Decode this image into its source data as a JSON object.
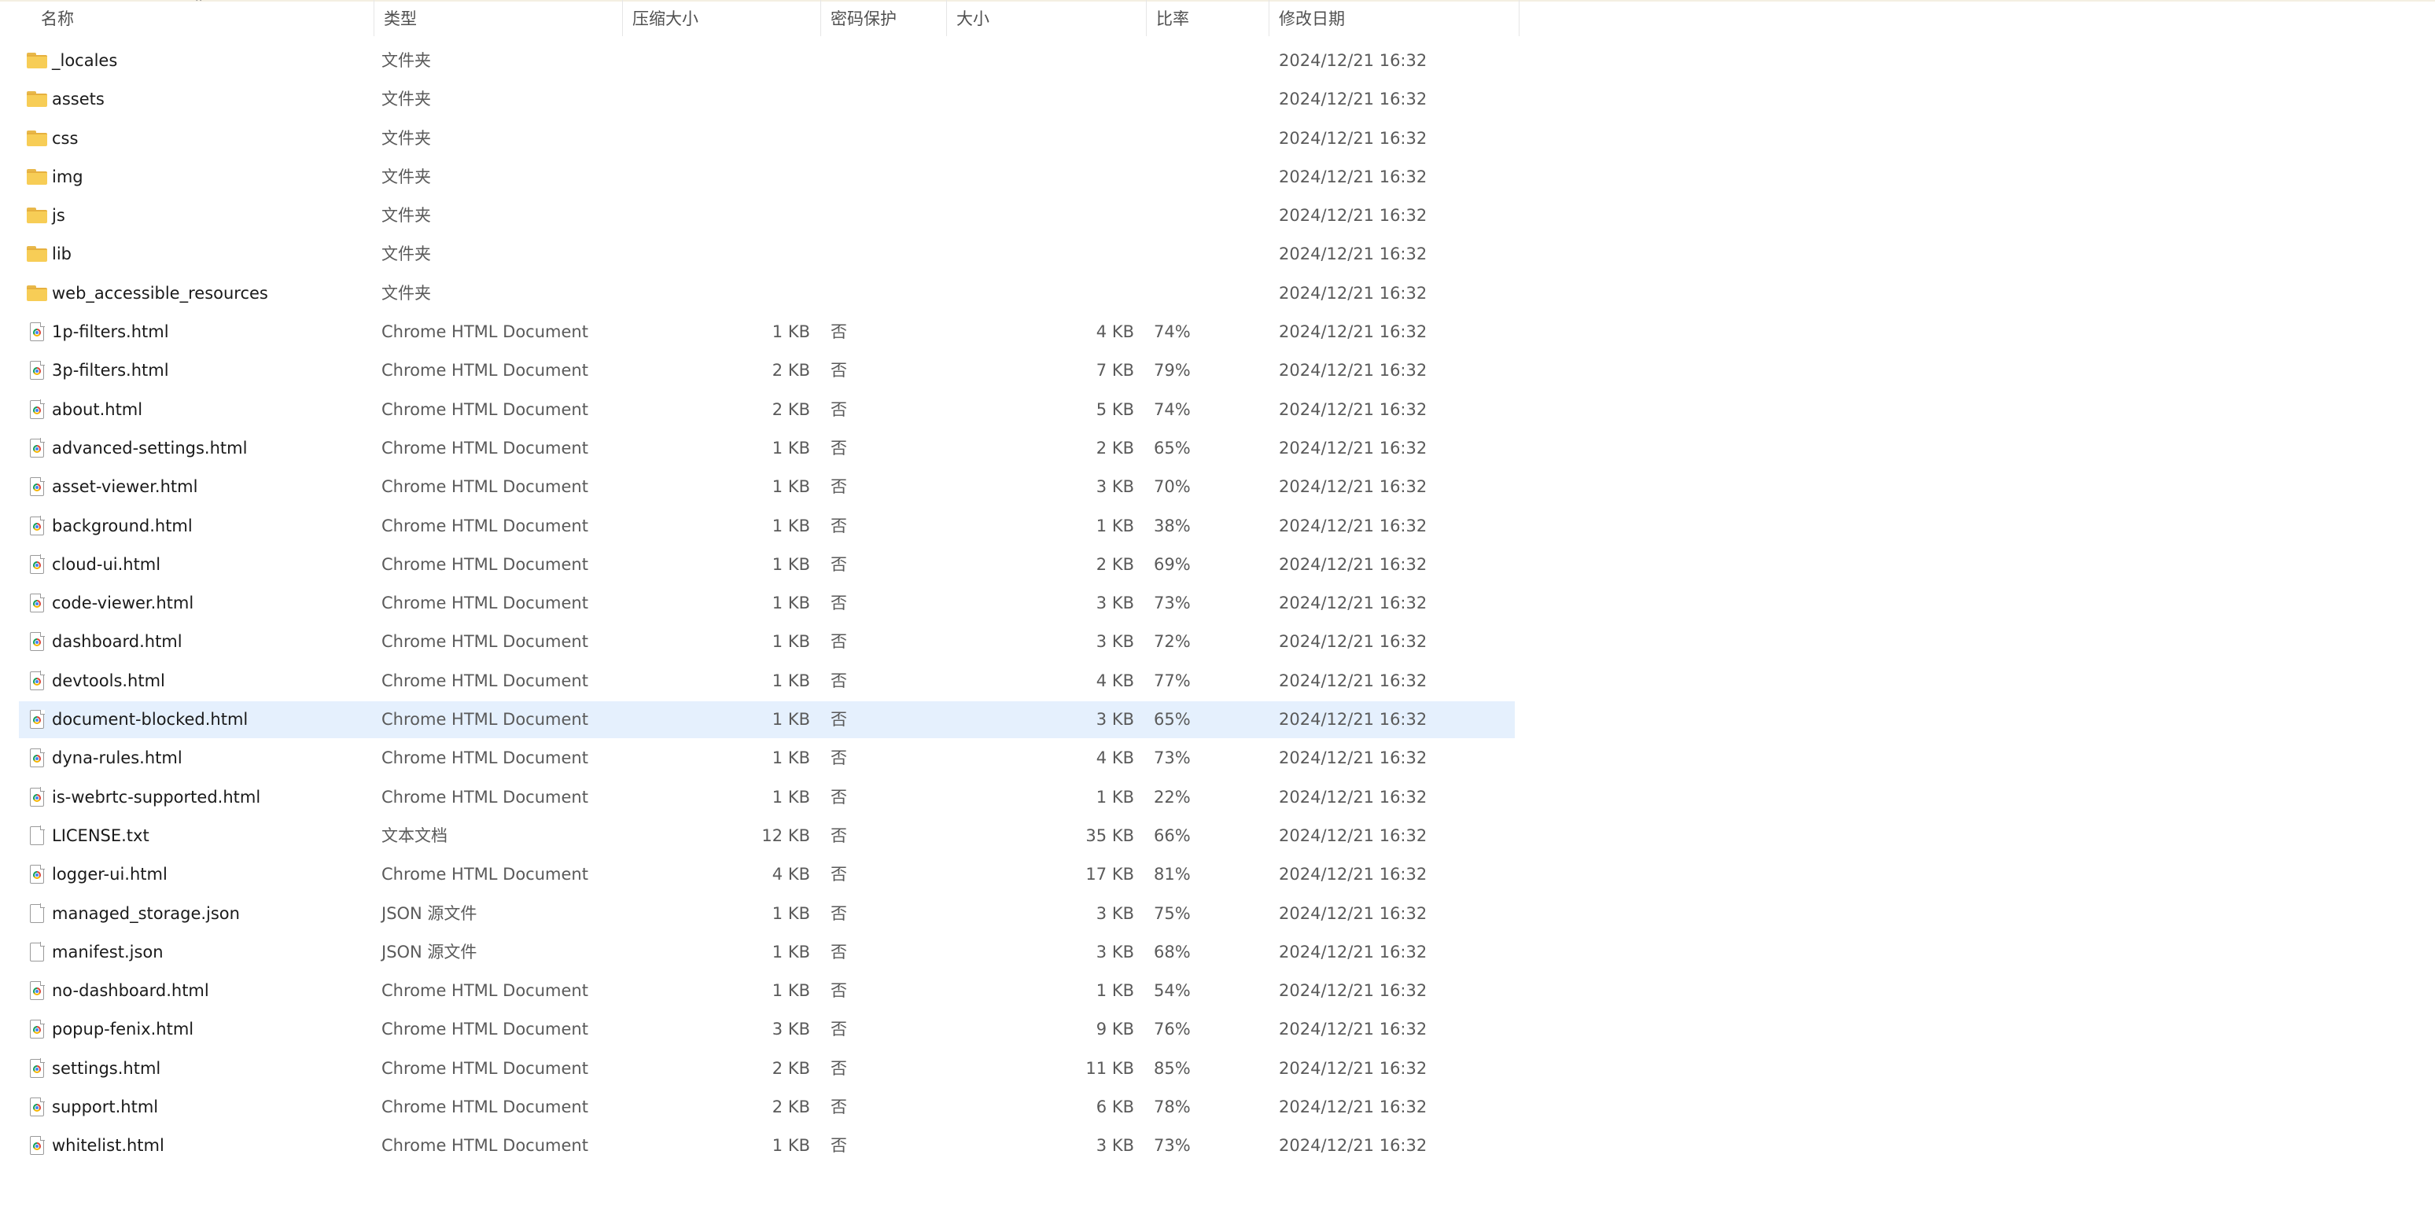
{
  "columns": {
    "name": "名称",
    "type": "类型",
    "compressed_size": "压缩大小",
    "password": "密码保护",
    "size": "大小",
    "ratio": "比率",
    "modified": "修改日期"
  },
  "rows": [
    {
      "name": "_locales",
      "icon": "folder-icon",
      "type": "文件夹",
      "compressed_size": "",
      "password": "",
      "size": "",
      "ratio": "",
      "modified": "2024/12/21 16:32"
    },
    {
      "name": "assets",
      "icon": "folder-icon",
      "type": "文件夹",
      "compressed_size": "",
      "password": "",
      "size": "",
      "ratio": "",
      "modified": "2024/12/21 16:32"
    },
    {
      "name": "css",
      "icon": "folder-icon",
      "type": "文件夹",
      "compressed_size": "",
      "password": "",
      "size": "",
      "ratio": "",
      "modified": "2024/12/21 16:32"
    },
    {
      "name": "img",
      "icon": "folder-icon",
      "type": "文件夹",
      "compressed_size": "",
      "password": "",
      "size": "",
      "ratio": "",
      "modified": "2024/12/21 16:32"
    },
    {
      "name": "js",
      "icon": "folder-icon",
      "type": "文件夹",
      "compressed_size": "",
      "password": "",
      "size": "",
      "ratio": "",
      "modified": "2024/12/21 16:32"
    },
    {
      "name": "lib",
      "icon": "folder-icon",
      "type": "文件夹",
      "compressed_size": "",
      "password": "",
      "size": "",
      "ratio": "",
      "modified": "2024/12/21 16:32"
    },
    {
      "name": "web_accessible_resources",
      "icon": "folder-icon",
      "type": "文件夹",
      "compressed_size": "",
      "password": "",
      "size": "",
      "ratio": "",
      "modified": "2024/12/21 16:32"
    },
    {
      "name": "1p-filters.html",
      "icon": "chrome-html-file-icon",
      "type": "Chrome HTML Document",
      "compressed_size": "1 KB",
      "password": "否",
      "size": "4 KB",
      "ratio": "74%",
      "modified": "2024/12/21 16:32"
    },
    {
      "name": "3p-filters.html",
      "icon": "chrome-html-file-icon",
      "type": "Chrome HTML Document",
      "compressed_size": "2 KB",
      "password": "否",
      "size": "7 KB",
      "ratio": "79%",
      "modified": "2024/12/21 16:32"
    },
    {
      "name": "about.html",
      "icon": "chrome-html-file-icon",
      "type": "Chrome HTML Document",
      "compressed_size": "2 KB",
      "password": "否",
      "size": "5 KB",
      "ratio": "74%",
      "modified": "2024/12/21 16:32"
    },
    {
      "name": "advanced-settings.html",
      "icon": "chrome-html-file-icon",
      "type": "Chrome HTML Document",
      "compressed_size": "1 KB",
      "password": "否",
      "size": "2 KB",
      "ratio": "65%",
      "modified": "2024/12/21 16:32"
    },
    {
      "name": "asset-viewer.html",
      "icon": "chrome-html-file-icon",
      "type": "Chrome HTML Document",
      "compressed_size": "1 KB",
      "password": "否",
      "size": "3 KB",
      "ratio": "70%",
      "modified": "2024/12/21 16:32"
    },
    {
      "name": "background.html",
      "icon": "chrome-html-file-icon",
      "type": "Chrome HTML Document",
      "compressed_size": "1 KB",
      "password": "否",
      "size": "1 KB",
      "ratio": "38%",
      "modified": "2024/12/21 16:32"
    },
    {
      "name": "cloud-ui.html",
      "icon": "chrome-html-file-icon",
      "type": "Chrome HTML Document",
      "compressed_size": "1 KB",
      "password": "否",
      "size": "2 KB",
      "ratio": "69%",
      "modified": "2024/12/21 16:32"
    },
    {
      "name": "code-viewer.html",
      "icon": "chrome-html-file-icon",
      "type": "Chrome HTML Document",
      "compressed_size": "1 KB",
      "password": "否",
      "size": "3 KB",
      "ratio": "73%",
      "modified": "2024/12/21 16:32"
    },
    {
      "name": "dashboard.html",
      "icon": "chrome-html-file-icon",
      "type": "Chrome HTML Document",
      "compressed_size": "1 KB",
      "password": "否",
      "size": "3 KB",
      "ratio": "72%",
      "modified": "2024/12/21 16:32"
    },
    {
      "name": "devtools.html",
      "icon": "chrome-html-file-icon",
      "type": "Chrome HTML Document",
      "compressed_size": "1 KB",
      "password": "否",
      "size": "4 KB",
      "ratio": "77%",
      "modified": "2024/12/21 16:32"
    },
    {
      "name": "document-blocked.html",
      "icon": "chrome-html-file-icon",
      "type": "Chrome HTML Document",
      "compressed_size": "1 KB",
      "password": "否",
      "size": "3 KB",
      "ratio": "65%",
      "modified": "2024/12/21 16:32",
      "selected": true
    },
    {
      "name": "dyna-rules.html",
      "icon": "chrome-html-file-icon",
      "type": "Chrome HTML Document",
      "compressed_size": "1 KB",
      "password": "否",
      "size": "4 KB",
      "ratio": "73%",
      "modified": "2024/12/21 16:32"
    },
    {
      "name": "is-webrtc-supported.html",
      "icon": "chrome-html-file-icon",
      "type": "Chrome HTML Document",
      "compressed_size": "1 KB",
      "password": "否",
      "size": "1 KB",
      "ratio": "22%",
      "modified": "2024/12/21 16:32"
    },
    {
      "name": "LICENSE.txt",
      "icon": "text-file-icon",
      "type": "文本文档",
      "compressed_size": "12 KB",
      "password": "否",
      "size": "35 KB",
      "ratio": "66%",
      "modified": "2024/12/21 16:32"
    },
    {
      "name": "logger-ui.html",
      "icon": "chrome-html-file-icon",
      "type": "Chrome HTML Document",
      "compressed_size": "4 KB",
      "password": "否",
      "size": "17 KB",
      "ratio": "81%",
      "modified": "2024/12/21 16:32"
    },
    {
      "name": "managed_storage.json",
      "icon": "json-file-icon",
      "type": "JSON 源文件",
      "compressed_size": "1 KB",
      "password": "否",
      "size": "3 KB",
      "ratio": "75%",
      "modified": "2024/12/21 16:32"
    },
    {
      "name": "manifest.json",
      "icon": "json-file-icon",
      "type": "JSON 源文件",
      "compressed_size": "1 KB",
      "password": "否",
      "size": "3 KB",
      "ratio": "68%",
      "modified": "2024/12/21 16:32"
    },
    {
      "name": "no-dashboard.html",
      "icon": "chrome-html-file-icon",
      "type": "Chrome HTML Document",
      "compressed_size": "1 KB",
      "password": "否",
      "size": "1 KB",
      "ratio": "54%",
      "modified": "2024/12/21 16:32"
    },
    {
      "name": "popup-fenix.html",
      "icon": "chrome-html-file-icon",
      "type": "Chrome HTML Document",
      "compressed_size": "3 KB",
      "password": "否",
      "size": "9 KB",
      "ratio": "76%",
      "modified": "2024/12/21 16:32"
    },
    {
      "name": "settings.html",
      "icon": "chrome-html-file-icon",
      "type": "Chrome HTML Document",
      "compressed_size": "2 KB",
      "password": "否",
      "size": "11 KB",
      "ratio": "85%",
      "modified": "2024/12/21 16:32"
    },
    {
      "name": "support.html",
      "icon": "chrome-html-file-icon",
      "type": "Chrome HTML Document",
      "compressed_size": "2 KB",
      "password": "否",
      "size": "6 KB",
      "ratio": "78%",
      "modified": "2024/12/21 16:32"
    },
    {
      "name": "whitelist.html",
      "icon": "chrome-html-file-icon",
      "type": "Chrome HTML Document",
      "compressed_size": "1 KB",
      "password": "否",
      "size": "3 KB",
      "ratio": "73%",
      "modified": "2024/12/21 16:32"
    }
  ]
}
